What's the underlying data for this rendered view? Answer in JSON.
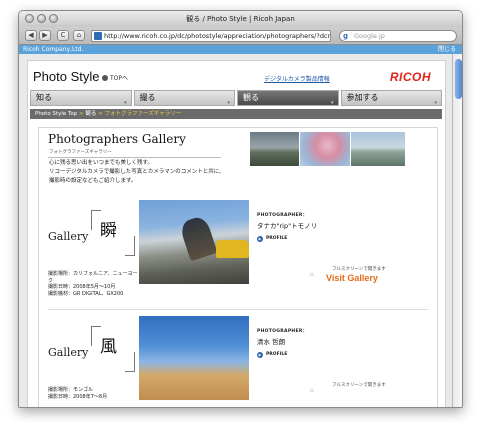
{
  "window": {
    "title": "観る / Photo Style | Ricoh Japan"
  },
  "toolbar": {
    "back_label": "◀",
    "forward_label": "▶",
    "reload_label": "C",
    "home_label": "⌂",
    "url": "http://www.ricoh.co.jp/dc/photostyle/appreciation/photographers/?dcm02",
    "search_placeholder": "Google.jp"
  },
  "infobar": {
    "text": "Ricoh Company,Ltd.",
    "close_label": "閉じる"
  },
  "site": {
    "brand": "Photo Style",
    "top_link": "TOPへ",
    "dc_link": "デジタルカメラ製品情報",
    "logo": "RICOH"
  },
  "nav": {
    "items": [
      {
        "label": "知る"
      },
      {
        "label": "撮る"
      },
      {
        "label": "観る",
        "active": true
      },
      {
        "label": "参加する"
      }
    ]
  },
  "breadcrumb": {
    "home": "Photo Style Top",
    "sep": ">",
    "section": "観る",
    "current": "フォトグラファーズギャラリー"
  },
  "gallery_intro": {
    "title": "Photographers Gallery",
    "subtitle": "フォトグラファーズギャラリー",
    "line1": "心に残る思い出をいつまでも美しく残す。",
    "line2": "リコーデジタルカメラで撮影した写真とカメラマンのコメントと共に、",
    "line3": "撮影時の設定などもご紹介します。"
  },
  "galleries": [
    {
      "word": "Gallery",
      "kanji": "瞬",
      "meta_place": "撮影場所：カリフォルニア、ニューヨーク",
      "meta_date": "撮影日時：2008年5月〜10月",
      "meta_camera": "撮影機材：GR DIGITAL、GX200",
      "photographer_label": "PHOTOGRAPHER：",
      "photographer_name": "タナカ\"rip\"トモノリ",
      "profile_label": "PROFILE",
      "fullscreen_note": "フルスクリーンで開きます",
      "visit_label": "Visit Gallery"
    },
    {
      "word": "Gallery",
      "kanji": "風",
      "meta_place": "撮影場所：モンゴル",
      "meta_date": "撮影日時：2008年7〜8月",
      "photographer_label": "PHOTOGRAPHER：",
      "photographer_name": "清水 哲朗",
      "profile_label": "PROFILE",
      "fullscreen_note": "フルスクリーンで開きます"
    }
  ],
  "colors": {
    "ricoh_red": "#e2231a",
    "visit_orange": "#e56a1a",
    "infobar_blue": "#5aa2d9",
    "breadcrumb_gold": "#f2c94c"
  }
}
